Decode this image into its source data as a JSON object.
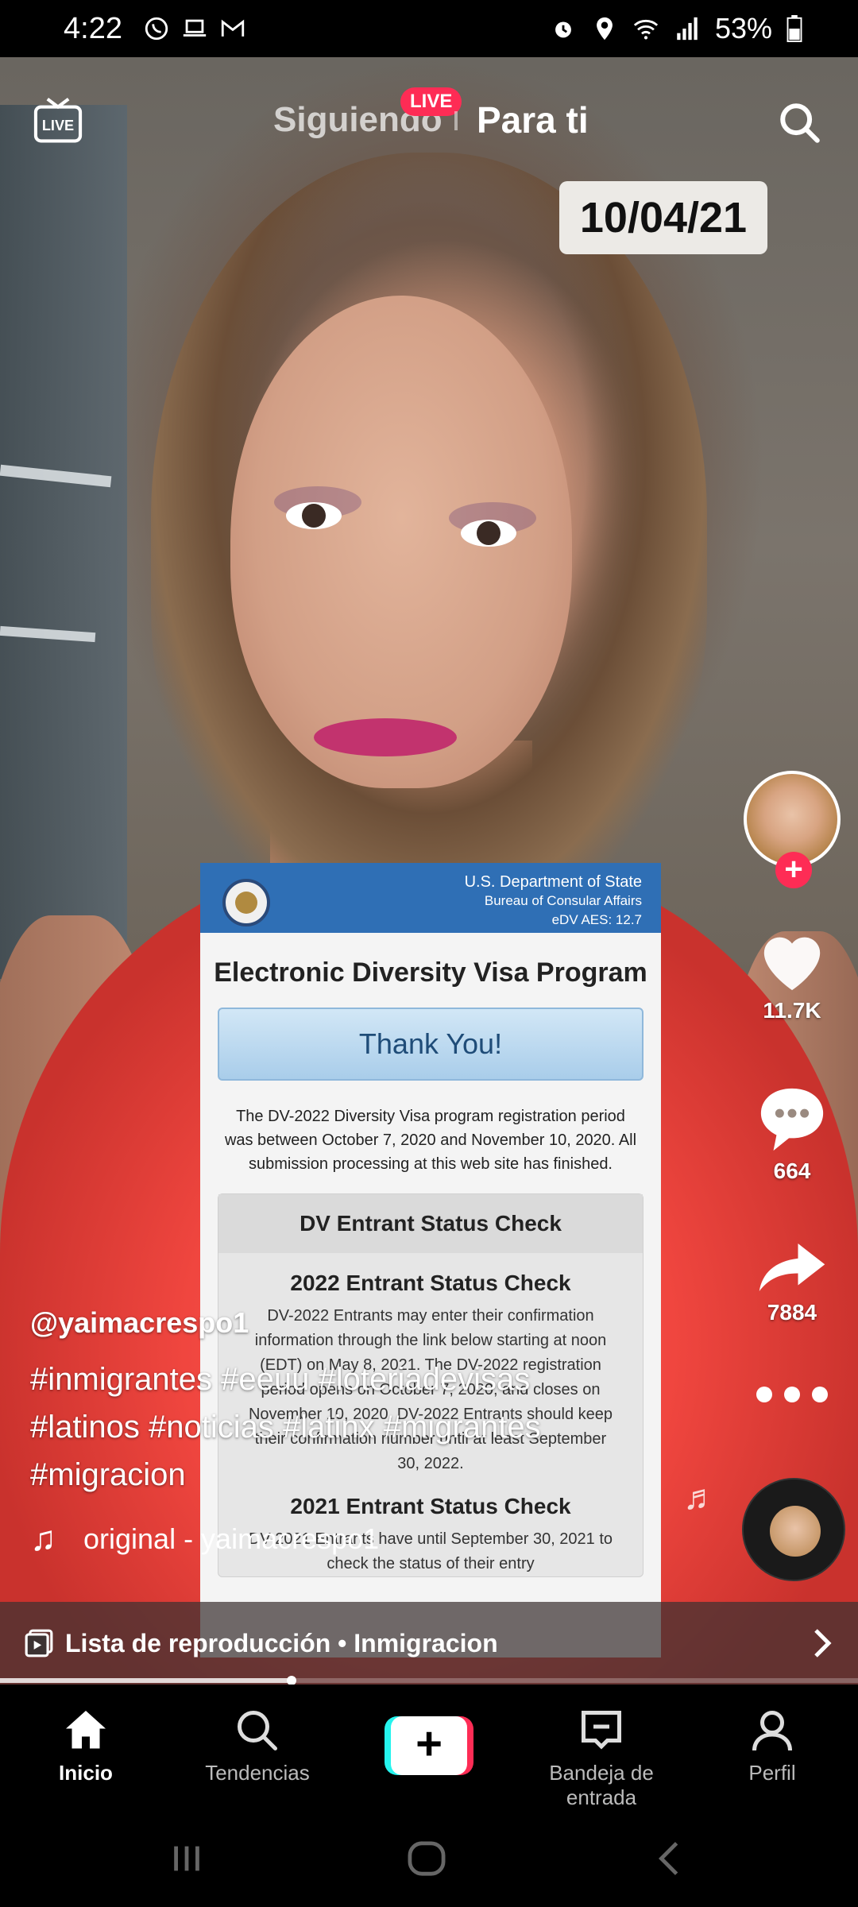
{
  "status_bar": {
    "time": "4:22",
    "battery": "53%",
    "left_icons": [
      "whatsapp-icon",
      "laptop-icon",
      "gmail-icon"
    ],
    "right_icons": [
      "alarm-icon",
      "location-icon",
      "wifi-icon",
      "signal-icon",
      "battery-icon"
    ]
  },
  "top_nav": {
    "live_label": "LIVE",
    "following": "Siguiendo",
    "live_badge": "LIVE",
    "for_you": "Para ti"
  },
  "video": {
    "date_overlay": "10/04/21",
    "document": {
      "dept": "U.S. Department of State",
      "bureau": "Bureau of Consular Affairs",
      "version": "eDV AES: 12.7",
      "title": "Electronic Diversity Visa Program",
      "thank_you": "Thank You!",
      "paragraph": "The DV-2022 Diversity Visa program registration period was between October 7, 2020 and November 10, 2020. All submission processing at this web site has finished.",
      "status_check": "DV Entrant Status Check",
      "sub1_title": "2022 Entrant Status Check",
      "sub1_text": "DV-2022 Entrants may enter their confirmation information through the link below starting at noon (EDT) on May 8, 2021. The DV-2022 registration period opens on October 7, 2020, and closes on November 10, 2020. DV-2022 Entrants should keep their confirmation number until at least September 30, 2022.",
      "sub2_title": "2021 Entrant Status Check",
      "sub2_text": "DV-2021 Entrants have until September 30, 2021 to check the status of their entry"
    }
  },
  "rail": {
    "likes": "11.7K",
    "comments": "664",
    "shares": "7884"
  },
  "caption": {
    "username": "@yaimacrespo1",
    "text": "#inmigrantes #eeuu #loteriadevisas #latinos #noticias #latinx #migrantes #migracion",
    "sound": "original - yaimacrespo1"
  },
  "playlist": {
    "label": "Lista de reproducción • Inmigracion"
  },
  "progress": 0.34,
  "bottom_nav": {
    "home": "Inicio",
    "discover": "Tendencias",
    "inbox": "Bandeja de entrada",
    "profile": "Perfil"
  }
}
